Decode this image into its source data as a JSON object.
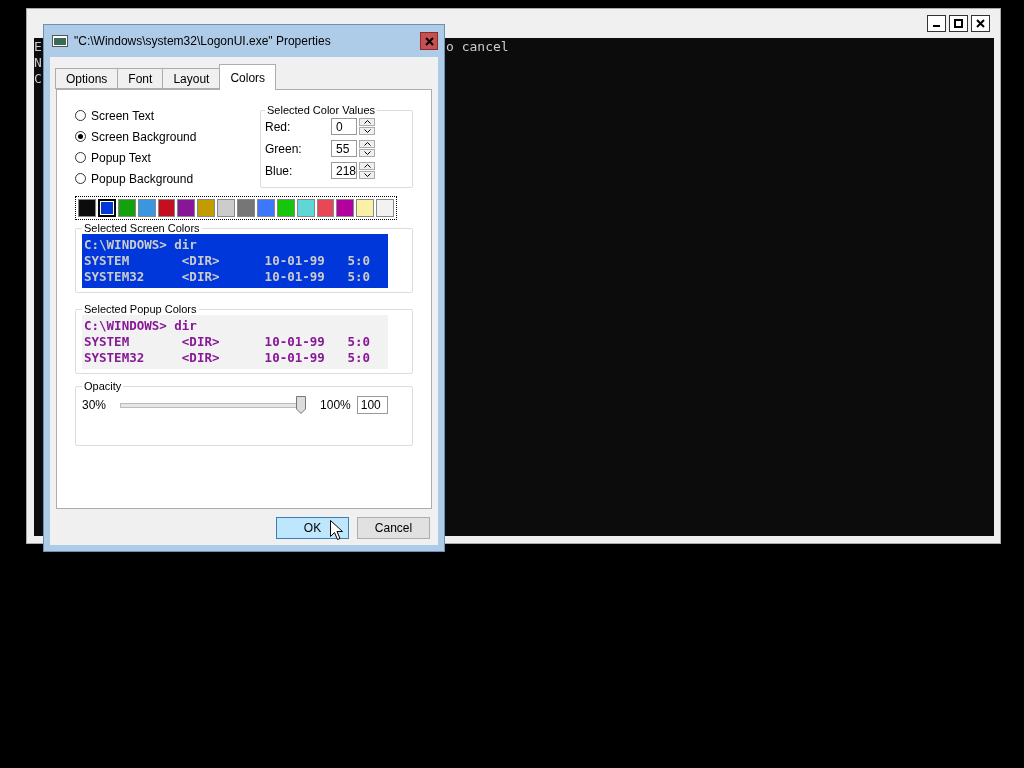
{
  "console": {
    "left_text": [
      "E",
      "N",
      "C"
    ],
    "right_text": "o cancel"
  },
  "dialog": {
    "title": "\"C:\\Windows\\system32\\LogonUI.exe\" Properties",
    "tabs": [
      {
        "label": "Options",
        "selected": false
      },
      {
        "label": "Font",
        "selected": false
      },
      {
        "label": "Layout",
        "selected": false
      },
      {
        "label": "Colors",
        "selected": true
      }
    ],
    "targets": [
      {
        "label": "Screen Text",
        "selected": false
      },
      {
        "label": "Screen Background",
        "selected": true
      },
      {
        "label": "Popup Text",
        "selected": false
      },
      {
        "label": "Popup Background",
        "selected": false
      }
    ],
    "color_values": {
      "title": "Selected Color Values",
      "fields": [
        {
          "label": "Red:",
          "value": "0"
        },
        {
          "label": "Green:",
          "value": "55"
        },
        {
          "label": "Blue:",
          "value": "218"
        }
      ]
    },
    "palette": [
      {
        "color": "#0c0c0c",
        "selected": false
      },
      {
        "color": "#0037da",
        "selected": true
      },
      {
        "color": "#13a10e",
        "selected": false
      },
      {
        "color": "#3a96dd",
        "selected": false
      },
      {
        "color": "#c50f1f",
        "selected": false
      },
      {
        "color": "#881798",
        "selected": false
      },
      {
        "color": "#c19c00",
        "selected": false
      },
      {
        "color": "#cccccc",
        "selected": false
      },
      {
        "color": "#767676",
        "selected": false
      },
      {
        "color": "#3b78ff",
        "selected": false
      },
      {
        "color": "#16c60c",
        "selected": false
      },
      {
        "color": "#61d6d6",
        "selected": false
      },
      {
        "color": "#e74856",
        "selected": false
      },
      {
        "color": "#b4009e",
        "selected": false
      },
      {
        "color": "#f9f1a5",
        "selected": false
      },
      {
        "color": "#f2f2f2",
        "selected": false
      }
    ],
    "previews": [
      {
        "title": "Selected Screen Colors",
        "color": "#0037da",
        "lines": [
          "C:\\WINDOWS> dir",
          "SYSTEM       <DIR>      10-01-99   5:0",
          "SYSTEM32     <DIR>      10-01-99   5:0"
        ]
      },
      {
        "title": "Selected Popup Colors",
        "color": "#f2f2f2",
        "lines": [
          "C:\\WINDOWS> dir",
          "SYSTEM       <DIR>      10-01-99   5:0",
          "SYSTEM32     <DIR>      10-01-99   5:0"
        ]
      }
    ],
    "opacity": {
      "title": "Opacity",
      "min_label": "30%",
      "max_label": "100%",
      "level": 1.0,
      "value": "100"
    },
    "buttons": [
      {
        "label": "OK",
        "default": true
      },
      {
        "label": "Cancel",
        "default": false
      }
    ]
  }
}
